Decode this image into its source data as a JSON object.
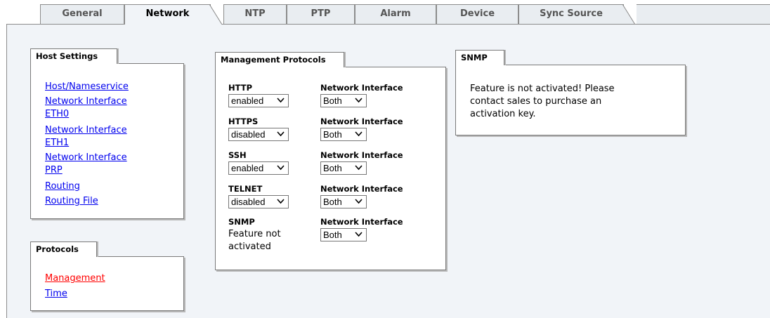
{
  "tabs": [
    {
      "label": "General",
      "active": false
    },
    {
      "label": "Network",
      "active": true
    },
    {
      "label": "NTP",
      "active": false
    },
    {
      "label": "PTP",
      "active": false
    },
    {
      "label": "Alarm",
      "active": false
    },
    {
      "label": "Device",
      "active": false
    },
    {
      "label": "Sync Source",
      "active": false
    }
  ],
  "host_settings": {
    "title": "Host Settings",
    "links": [
      [
        "Host/Nameservice"
      ],
      [
        "Network Interface",
        "ETH0"
      ],
      [
        "Network Interface",
        "ETH1"
      ],
      [
        "Network Interface",
        "PRP"
      ],
      [
        "Routing"
      ],
      [
        "Routing File"
      ]
    ]
  },
  "protocols": {
    "title": "Protocols",
    "links": [
      "Management",
      "Time"
    ],
    "current": "Management"
  },
  "management": {
    "title": "Management Protocols",
    "rows": [
      {
        "name": "HTTP",
        "status": "enabled",
        "iface_label": "Network Interface",
        "iface": "Both"
      },
      {
        "name": "HTTPS",
        "status": "disabled",
        "iface_label": "Network Interface",
        "iface": "Both"
      },
      {
        "name": "SSH",
        "status": "enabled",
        "iface_label": "Network Interface",
        "iface": "Both"
      },
      {
        "name": "TELNET",
        "status": "disabled",
        "iface_label": "Network Interface",
        "iface": "Both"
      }
    ],
    "snmp_row": {
      "name": "SNMP",
      "note_line1": "Feature not",
      "note_line2": "activated",
      "iface_label": "Network Interface",
      "iface": "Both"
    }
  },
  "snmp": {
    "title": "SNMP",
    "lines": [
      "Feature is not activated! Please",
      "contact sales to purchase an",
      "activation key."
    ]
  }
}
